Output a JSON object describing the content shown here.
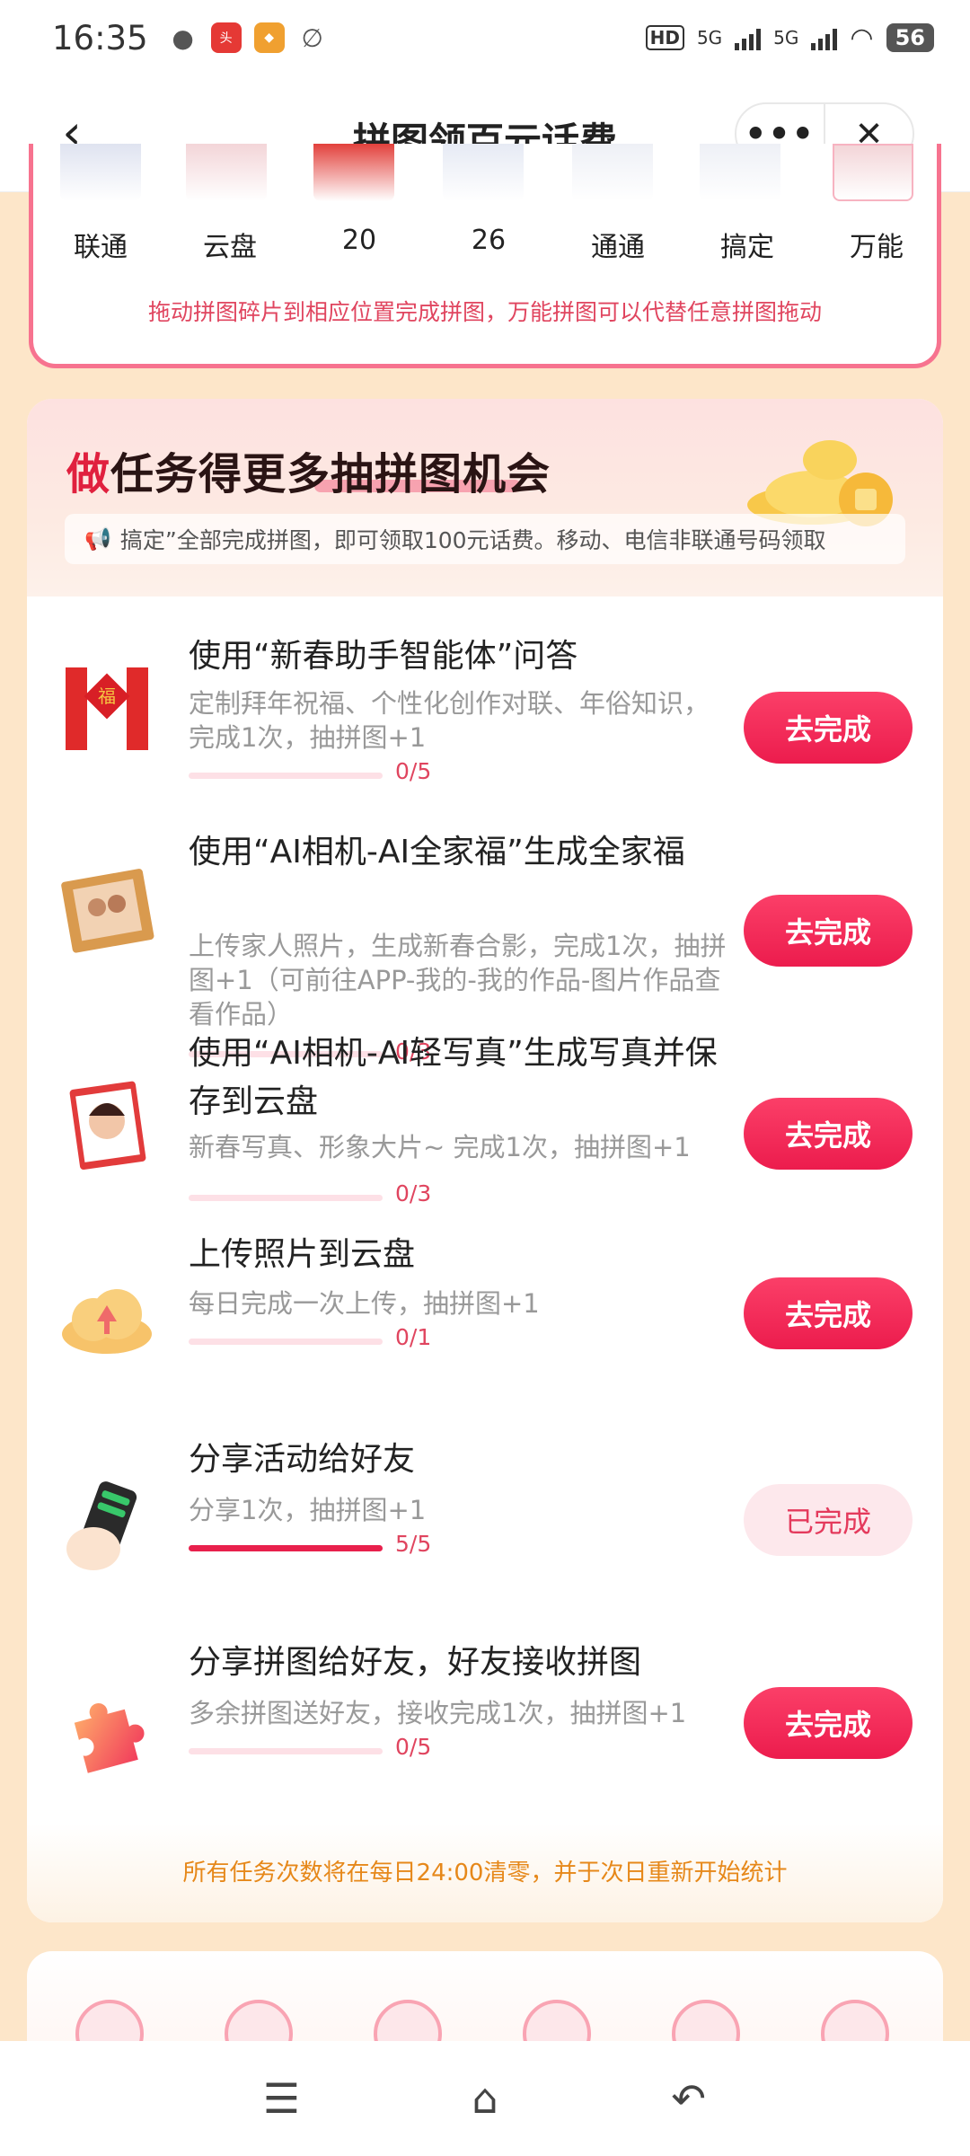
{
  "status_bar": {
    "time": "16:35",
    "network": "HD",
    "signal1": "5G",
    "signal2": "5G",
    "battery": "56"
  },
  "header": {
    "title": "拼图领百元话费",
    "back_icon": "chevron-left-icon",
    "more_icon": "more-dots-icon",
    "close_icon": "close-icon"
  },
  "puzzle": {
    "pieces": [
      "联通",
      "云盘",
      "20",
      "26",
      "通通",
      "搞定",
      "万能"
    ],
    "hint": "拖动拼图碎片到相应位置完成拼图，万能拼图可以代替任意拼图拖动"
  },
  "tasks_section": {
    "title": "做任务得更多抽拼图机会",
    "marquee": "搞定”全部完成拼图，即可领取100元话费。移动、电信非联通号码领取",
    "items": [
      {
        "title": "使用“新春助手智能体”问答",
        "desc": "定制拜年祝福、个性化创作对联、年俗知识，完成1次，抽拼图+1",
        "progress_text": "0/5",
        "progress": 0,
        "button": "去完成",
        "icon": "spring-couplet-icon"
      },
      {
        "title": "使用“AI相机-AI全家福”生成全家福",
        "desc": "上传家人照片，生成新春合影，完成1次，抽拼图+1（可前往APP-我的-我的作品-图片作品查看作品）",
        "progress_text": "0/3",
        "progress": 0,
        "button": "去完成",
        "icon": "family-photo-icon"
      },
      {
        "title": "使用“AI相机-AI轻写真”生成写真并保存到云盘",
        "desc": "新春写真、形象大片~ 完成1次，抽拼图+1",
        "progress_text": "0/3",
        "progress": 0,
        "button": "去完成",
        "icon": "portrait-photo-icon"
      },
      {
        "title": "上传照片到云盘",
        "desc": "每日完成一次上传，抽拼图+1",
        "progress_text": "0/1",
        "progress": 0,
        "button": "去完成",
        "icon": "cloud-upload-icon"
      },
      {
        "title": "分享活动给好友",
        "desc": "分享1次，抽拼图+1",
        "progress_text": "5/5",
        "progress": 1,
        "button": "已完成",
        "icon": "phone-share-icon"
      },
      {
        "title": "分享拼图给好友，好友接收拼图",
        "desc": "多余拼图送好友，接收完成1次，抽拼图+1",
        "progress_text": "0/5",
        "progress": 0,
        "button": "去完成",
        "icon": "puzzle-piece-icon"
      }
    ],
    "footer": "所有任务次数将在每日24:00清零，并于次日重新开始统计"
  },
  "bottom_nav": {
    "menu_icon": "menu-icon",
    "home_icon": "home-icon",
    "back_icon": "back-arrow-icon"
  },
  "colors": {
    "accent": "#ec1c4d",
    "background": "#fde6c9",
    "hint": "#e0455f",
    "footer_text": "#e6881a"
  }
}
